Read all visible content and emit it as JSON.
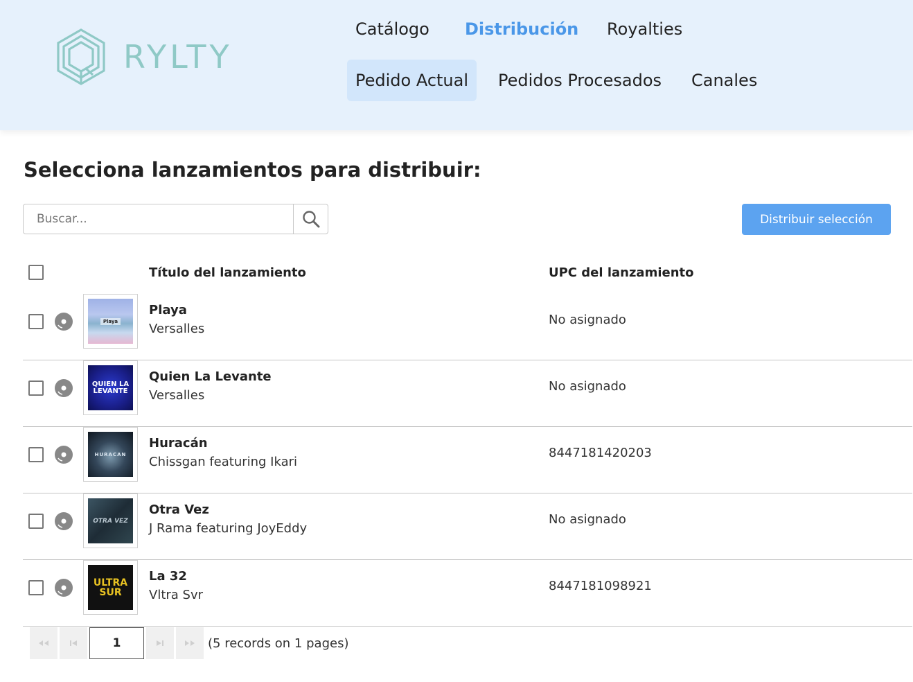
{
  "app": {
    "brand": "RYLTY"
  },
  "nav": {
    "top": [
      {
        "label": "Catálogo",
        "active": false
      },
      {
        "label": "Distribución",
        "active": true
      },
      {
        "label": "Royalties",
        "active": false
      }
    ],
    "sub": [
      {
        "label": "Pedido Actual",
        "active": true
      },
      {
        "label": "Pedidos Procesados",
        "active": false
      },
      {
        "label": "Canales",
        "active": false
      }
    ]
  },
  "main": {
    "title": "Selecciona lanzamientos para distribuir:",
    "search": {
      "placeholder": "Buscar...",
      "value": "",
      "icon": "search-icon"
    },
    "distribute_button": "Distribuir selección"
  },
  "table": {
    "columns": {
      "title": "Título del lanzamiento",
      "upc": "UPC del lanzamiento"
    },
    "rows": [
      {
        "title": "Playa",
        "artist": "Versalles",
        "upc": "No asignado",
        "cover_text": "Playa",
        "checked": false
      },
      {
        "title": "Quien La Levante",
        "artist": "Versalles",
        "upc": "No asignado",
        "cover_text": "QUIEN LA LEVANTE",
        "checked": false
      },
      {
        "title": "Huracán",
        "artist": "Chissgan featuring Ikari",
        "upc": "8447181420203",
        "cover_text": "HURACAN",
        "checked": false
      },
      {
        "title": "Otra Vez",
        "artist": "J Rama featuring JoyEddy",
        "upc": "No asignado",
        "cover_text": "OTRA VEZ",
        "checked": false
      },
      {
        "title": "La 32",
        "artist": "Vltra Svr",
        "upc": "8447181098921",
        "cover_text": "ULTRA SUR",
        "checked": false
      }
    ]
  },
  "pager": {
    "current_page": "1",
    "info": "(5 records on 1 pages)"
  },
  "colors": {
    "header_bg": "#e6f1fc",
    "accent": "#4a97e8",
    "button": "#5ca3f0",
    "logo": "#8fc9c6"
  }
}
